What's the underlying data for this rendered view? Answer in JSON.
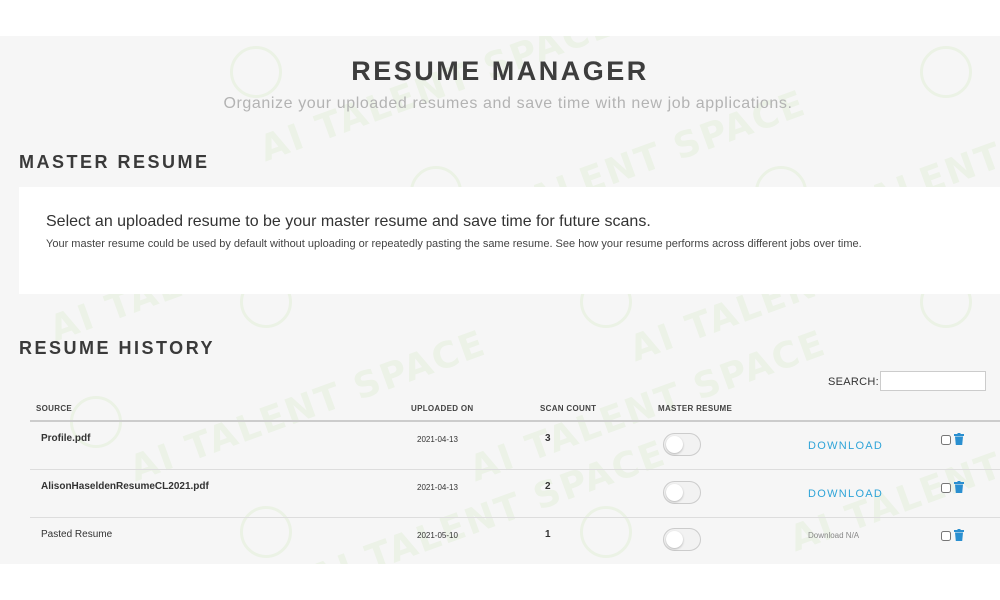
{
  "header": {
    "title": "RESUME MANAGER",
    "subtitle": "Organize your uploaded resumes and save time with new job applications."
  },
  "master": {
    "section_title": "MASTER RESUME",
    "heading": "Select an uploaded resume to be your master resume and save time for future scans.",
    "description": "Your master resume could be used by default without uploading or repeatedly pasting the same resume. See how your resume performs across different jobs over time."
  },
  "history": {
    "section_title": "RESUME HISTORY",
    "search": {
      "label": "SEARCH:",
      "value": "",
      "placeholder": ""
    },
    "columns": {
      "source": "SOURCE",
      "uploaded_on": "UPLOADED ON",
      "scan_count": "SCAN COUNT",
      "master_resume": "MASTER RESUME"
    },
    "rows": [
      {
        "source": "Profile.pdf",
        "uploaded_on": "2021-04-13",
        "scan_count": "3",
        "master": false,
        "download": "DOWNLOAD",
        "download_available": true,
        "checked": false
      },
      {
        "source": "AlisonHaseldenResumeCL2021.pdf",
        "uploaded_on": "2021-04-13",
        "scan_count": "2",
        "master": false,
        "download": "DOWNLOAD",
        "download_available": true,
        "checked": false
      },
      {
        "source": "Pasted Resume",
        "uploaded_on": "2021-05-10",
        "scan_count": "1",
        "master": false,
        "download": "Download N/A",
        "download_available": false,
        "checked": false
      }
    ]
  },
  "watermark": {
    "text": "AI TALENT SPACE",
    "color": "#78c828"
  },
  "icons": {
    "toggle": "toggle-switch-icon",
    "delete": "trash-icon"
  },
  "colors": {
    "accent": "#2fa4d8",
    "delete": "#2a8fd0",
    "background": "#f6f6f6"
  }
}
